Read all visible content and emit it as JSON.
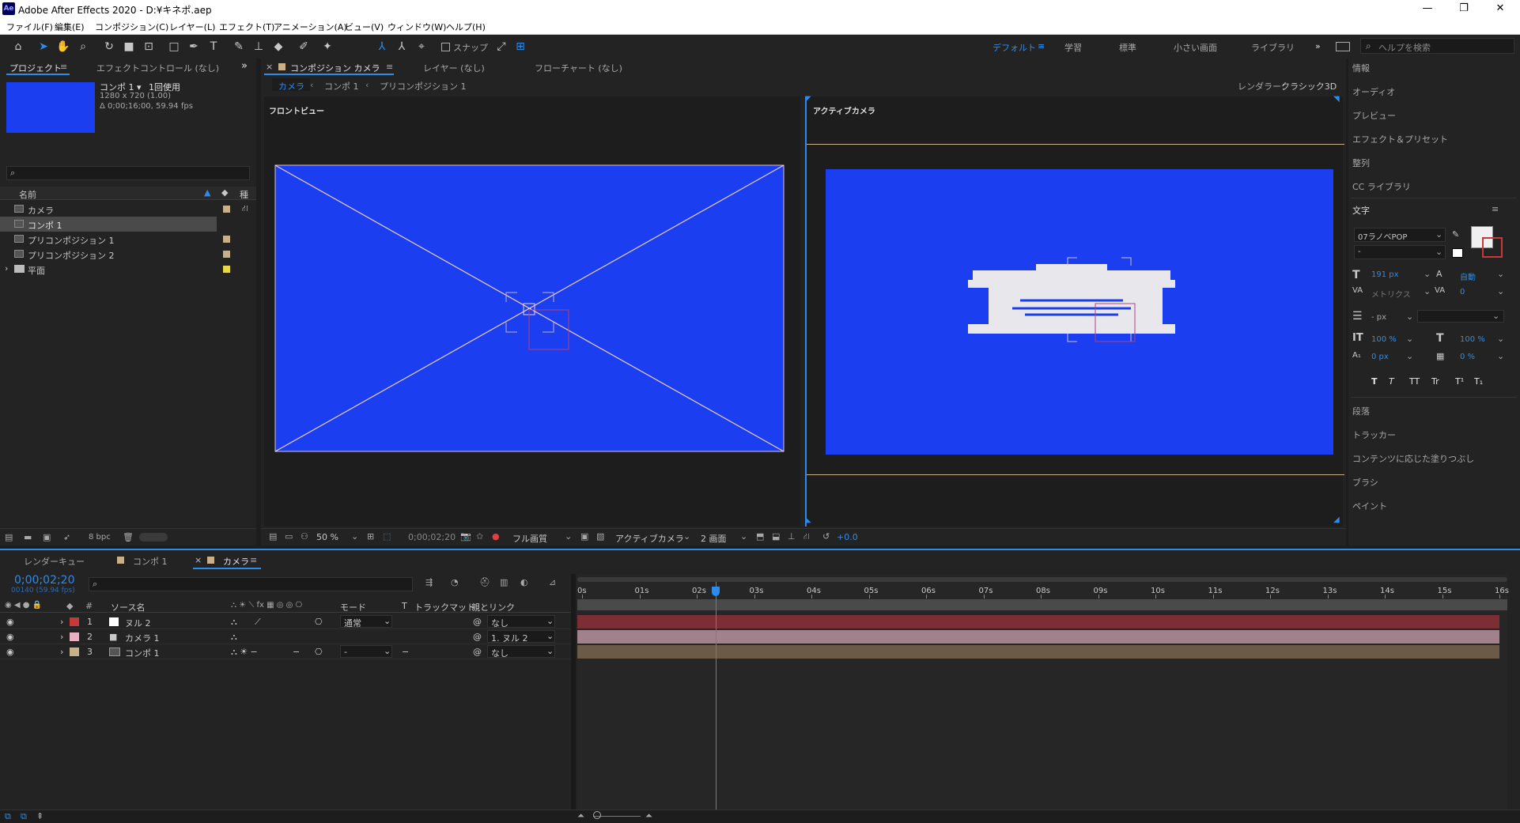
{
  "app": {
    "title": "Adobe After Effects 2020 - D:¥キネポ.aep",
    "logo": "Ae"
  },
  "menu": [
    "ファイル(F)",
    "編集(E)",
    "コンポジション(C)",
    "レイヤー(L)",
    "エフェクト(T)",
    "アニメーション(A)",
    "ビュー(V)",
    "ウィンドウ(W)",
    "ヘルプ(H)"
  ],
  "toolbar": {
    "snap_label": "スナップ",
    "workspaces": [
      "デフォルト",
      "学習",
      "標準",
      "小さい画面",
      "ライブラリ"
    ],
    "help_placeholder": "ヘルプを検索"
  },
  "project": {
    "tab_project": "プロジェクト",
    "tab_effect": "エフェクトコントロール (なし)",
    "thumb_color": "#1a3ef0",
    "comp_name": "コンポ 1 ▾",
    "usage": "1回使用",
    "size": "1280 x 720 (1.00)",
    "duration": "Δ 0;00;16;00, 59.94 fps",
    "search_placeholder": "",
    "col_name": "名前",
    "col_type": "種",
    "items": [
      {
        "label": "カメラ",
        "color": "#c8b08a"
      },
      {
        "label": "コンポ 1",
        "color": "#c8b08a"
      },
      {
        "label": "プリコンポジション 1",
        "color": "#c8b08a"
      },
      {
        "label": "プリコンポジション 2",
        "color": "#c8b08a"
      },
      {
        "label": "平面",
        "color": "#e6d84a"
      }
    ],
    "bpc": "8 bpc"
  },
  "comp": {
    "tab_label": "コンポジション カメラ",
    "tab_layer": "レイヤー (なし)",
    "tab_flow": "フローチャート (なし)",
    "crumb_active": "カメラ",
    "crumb_2": "コンポ 1",
    "crumb_3": "プリコンポジション 1",
    "renderer_label": "レンダラー：",
    "renderer_value": "クラシック3D",
    "view_left": "フロントビュー",
    "view_right": "アクティブカメラ",
    "zoom": "50 %",
    "timecode": "0;00;02;20",
    "quality": "フル画質",
    "camera": "アクティブカメラ",
    "layout": "2 画面",
    "exposure": "+0.0",
    "canvas_color": "#1a3ef0"
  },
  "right_panel": {
    "items_top": [
      "情報",
      "オーディオ",
      "プレビュー",
      "エフェクト＆プリセット",
      "整列",
      "CC ライブラリ"
    ],
    "text_title": "文字",
    "font": "07ラノベPOP",
    "style": "-",
    "font_size": "191 px",
    "leading": "自動",
    "kerning": "メトリクス",
    "tracking": "0",
    "stroke": "- px",
    "v_scale": "100 %",
    "h_scale": "100 %",
    "baseline": "0 px",
    "tsume": "0 %",
    "style_buttons": [
      "T",
      "T",
      "TT",
      "Tr",
      "T¹",
      "T₁"
    ],
    "items_bottom": [
      "段落",
      "トラッカー",
      "コンテンツに応じた塗りつぶし",
      "ブラシ",
      "ペイント"
    ]
  },
  "timeline": {
    "tab_render": "レンダーキュー",
    "tab_comp1": "コンポ 1",
    "tab_camera": "カメラ",
    "timecode": "0;00;02;20",
    "frames": "00140 (59.94 fps)",
    "col_source": "ソース名",
    "col_mode": "モード",
    "col_t": "T",
    "col_matte": "トラックマット",
    "col_parent": "親とリンク",
    "layers": [
      {
        "num": "1",
        "name": "ヌル 2",
        "color": "#c43a3a",
        "mode": "通常",
        "parent": "なし",
        "bar": "#7b2f35"
      },
      {
        "num": "2",
        "name": "カメラ 1",
        "color": "#e8b0c0",
        "mode": "",
        "parent": "1. ヌル 2",
        "bar": "#a0818c"
      },
      {
        "num": "3",
        "name": "コンポ 1",
        "color": "#c8b08a",
        "mode": "-",
        "parent": "なし",
        "bar": "#6b5a48"
      }
    ],
    "ruler": [
      "0s",
      "01s",
      "02s",
      "03s",
      "04s",
      "05s",
      "06s",
      "07s",
      "08s",
      "09s",
      "10s",
      "11s",
      "12s",
      "13s",
      "14s",
      "15s",
      "16s"
    ],
    "playhead_seconds": 2.33
  }
}
